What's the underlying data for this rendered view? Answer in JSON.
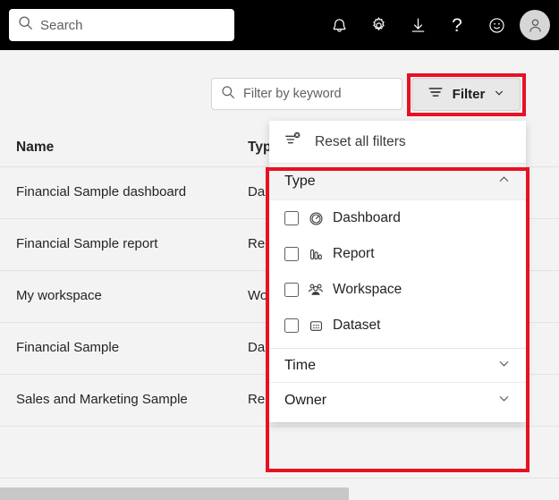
{
  "topbar": {
    "search": {
      "placeholder": "Search",
      "icon": "search-icon"
    },
    "icons": [
      {
        "name": "notifications-bell-icon"
      },
      {
        "name": "settings-gear-icon"
      },
      {
        "name": "download-icon"
      },
      {
        "name": "help-question-icon",
        "glyph": "?"
      },
      {
        "name": "feedback-smiley-icon"
      },
      {
        "name": "account-avatar-icon"
      }
    ]
  },
  "toolbar": {
    "keyword_filter": {
      "placeholder": "Filter by keyword",
      "icon": "search-icon"
    },
    "filter_button": {
      "label": "Filter",
      "icon": "filter-lines-icon",
      "chevron": "chevron-down-icon",
      "state": "pressed"
    }
  },
  "table": {
    "columns": [
      "Name",
      "Type"
    ],
    "rows": [
      {
        "name": "Financial Sample dashboard",
        "type": "Da"
      },
      {
        "name": "Financial Sample report",
        "type": "Rep"
      },
      {
        "name": "My workspace",
        "type": "Wo"
      },
      {
        "name": "Financial Sample",
        "type": "Da"
      },
      {
        "name": "Sales and Marketing Sample",
        "type": "Rep"
      }
    ]
  },
  "filter_panel": {
    "reset": {
      "label": "Reset all filters",
      "icon": "reset-filters-icon"
    },
    "sections": [
      {
        "label": "Type",
        "expanded": true,
        "chevron": "chevron-up-icon"
      },
      {
        "label": "Time",
        "expanded": false,
        "chevron": "chevron-down-icon"
      },
      {
        "label": "Owner",
        "expanded": false,
        "chevron": "chevron-down-icon"
      }
    ],
    "type_options": [
      {
        "label": "Dashboard",
        "icon": "dashboard-gauge-icon",
        "checked": false
      },
      {
        "label": "Report",
        "icon": "report-bars-icon",
        "checked": false
      },
      {
        "label": "Workspace",
        "icon": "workspace-people-icon",
        "checked": false
      },
      {
        "label": "Dataset",
        "icon": "dataset-grid-icon",
        "checked": false
      }
    ]
  },
  "highlight": {
    "color": "#e81123"
  },
  "colors": {
    "topbar_bg": "#000000",
    "page_bg": "#f3f3f3",
    "panel_bg": "#ffffff",
    "accent_highlight": "#e81123",
    "text": "#242424"
  }
}
